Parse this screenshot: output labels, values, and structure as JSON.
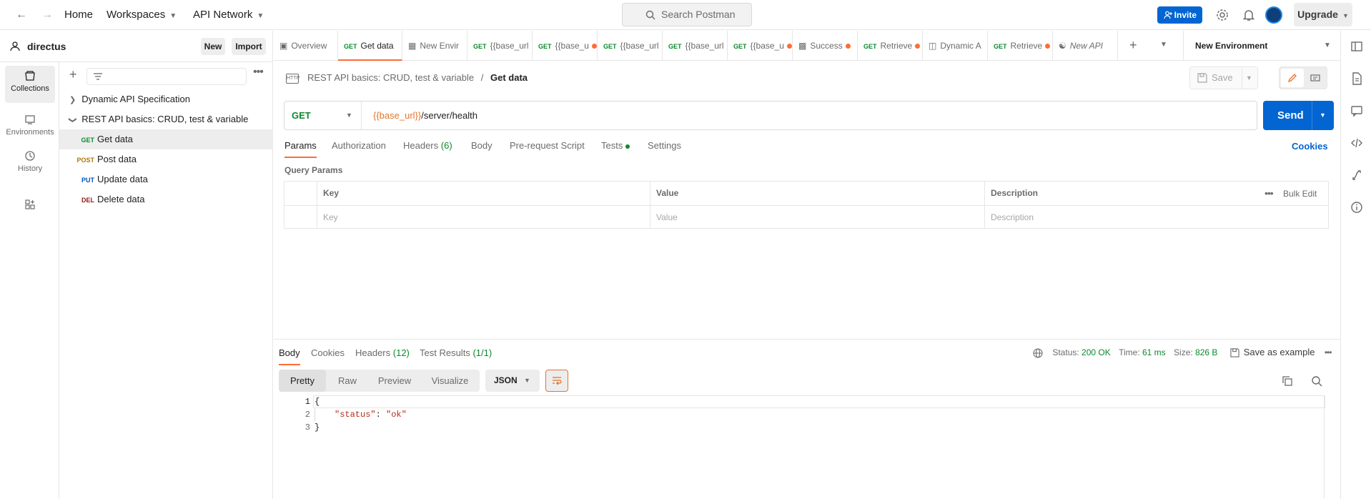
{
  "topbar": {
    "home": "Home",
    "workspaces": "Workspaces",
    "api_network": "API Network",
    "search_placeholder": "Search Postman",
    "invite": "Invite",
    "upgrade": "Upgrade"
  },
  "workspace": {
    "name": "directus",
    "new_label": "New",
    "import_label": "Import"
  },
  "rail": {
    "items": [
      {
        "label": "Collections",
        "icon": "collections-icon"
      },
      {
        "label": "Environments",
        "icon": "environments-icon"
      },
      {
        "label": "History",
        "icon": "history-icon"
      },
      {
        "label": "",
        "icon": "add-apps-icon"
      }
    ]
  },
  "tree": {
    "items": [
      {
        "type": "folder",
        "label": "Dynamic API Specification",
        "expanded": false
      },
      {
        "type": "folder",
        "label": "REST API basics: CRUD, test & variable",
        "expanded": true
      },
      {
        "type": "request",
        "method": "GET",
        "label": "Get data",
        "selected": true
      },
      {
        "type": "request",
        "method": "POST",
        "label": "Post data"
      },
      {
        "type": "request",
        "method": "PUT",
        "label": "Update data"
      },
      {
        "type": "request",
        "method": "DEL",
        "label": "Delete data"
      }
    ]
  },
  "tabs": [
    {
      "method": "",
      "label": "Overview"
    },
    {
      "method": "GET",
      "label": "Get data",
      "active": true
    },
    {
      "method": "",
      "label": "New Envir"
    },
    {
      "method": "GET",
      "label": "{{base_url"
    },
    {
      "method": "GET",
      "label": "{{base_u",
      "dot": true
    },
    {
      "method": "GET",
      "label": "{{base_url"
    },
    {
      "method": "GET",
      "label": "{{base_url"
    },
    {
      "method": "GET",
      "label": "{{base_u",
      "dot": true
    },
    {
      "method": "",
      "label": "Success",
      "dot": true
    },
    {
      "method": "GET",
      "label": "Retrieve",
      "dot": true
    },
    {
      "method": "",
      "label": "Dynamic A"
    },
    {
      "method": "GET",
      "label": "Retrieve",
      "dot": true
    },
    {
      "method": "",
      "label": "New API"
    }
  ],
  "environment": {
    "selected": "New Environment"
  },
  "breadcrumb": {
    "collection": "REST API basics: CRUD, test & variable",
    "separator": "/",
    "request": "Get data"
  },
  "save_label": "Save",
  "request": {
    "method": "GET",
    "url_var": "{{base_url}}",
    "url_path": "/server/health",
    "send_label": "Send"
  },
  "request_tabs": {
    "params": "Params",
    "authorization": "Authorization",
    "headers": "Headers",
    "headers_count": "(6)",
    "body": "Body",
    "pre_request": "Pre-request Script",
    "tests": "Tests",
    "settings": "Settings",
    "cookies": "Cookies"
  },
  "query_params": {
    "title": "Query Params",
    "columns": [
      "Key",
      "Value",
      "Description"
    ],
    "bulk_edit": "Bulk Edit",
    "placeholders": [
      "Key",
      "Value",
      "Description"
    ]
  },
  "response": {
    "tabs": {
      "body": "Body",
      "cookies": "Cookies",
      "headers": "Headers",
      "headers_count": "(12)",
      "tests": "Test Results",
      "tests_count": "(1/1)"
    },
    "status_label": "Status:",
    "status": "200 OK",
    "time_label": "Time:",
    "time": "61 ms",
    "size_label": "Size:",
    "size": "826 B",
    "save_example": "Save as example",
    "views": [
      "Pretty",
      "Raw",
      "Preview",
      "Visualize"
    ],
    "format": "JSON",
    "code": {
      "line1": "{",
      "line2_key": "\"status\"",
      "line2_sep": ": ",
      "line2_val": "\"ok\"",
      "line3": "}",
      "numbers": [
        "1",
        "2",
        "3"
      ]
    }
  },
  "colors": {
    "accent": "#ff6c37",
    "primary": "#0265d2",
    "get": "#0b8a2e"
  }
}
